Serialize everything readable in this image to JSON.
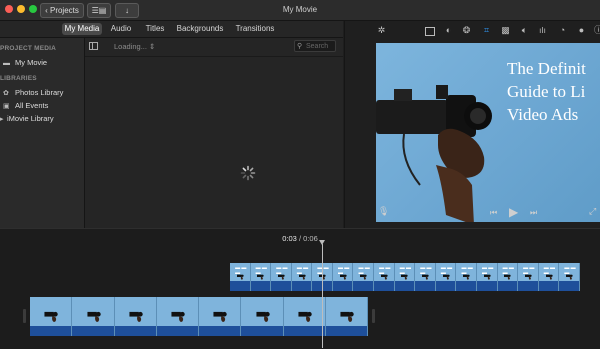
{
  "window": {
    "title": "My Movie",
    "projects_button": "Projects",
    "view_button": "☰▤",
    "import_button": "↓"
  },
  "tabs": [
    {
      "label": "My Media",
      "active": true
    },
    {
      "label": "Audio",
      "active": false
    },
    {
      "label": "Titles",
      "active": false
    },
    {
      "label": "Backgrounds",
      "active": false
    },
    {
      "label": "Transitions",
      "active": false
    }
  ],
  "sidebar": {
    "project_media_heading": "PROJECT MEDIA",
    "project_item": "My Movie",
    "libraries_heading": "LIBRARIES",
    "library_items": [
      "Photos Library",
      "All Events",
      "iMovie Library"
    ]
  },
  "browser": {
    "loading_label": "Loading...",
    "search_placeholder": "Search"
  },
  "viewer": {
    "title_lines": [
      "The Definit",
      "Guide to Li",
      "Video Ads"
    ]
  },
  "timeline": {
    "current_time": "0:03",
    "separator": "/",
    "total_time": "0:06"
  },
  "colors": {
    "accent_blue": "#1e4f9a",
    "sky_blue": "#7db5dd"
  }
}
